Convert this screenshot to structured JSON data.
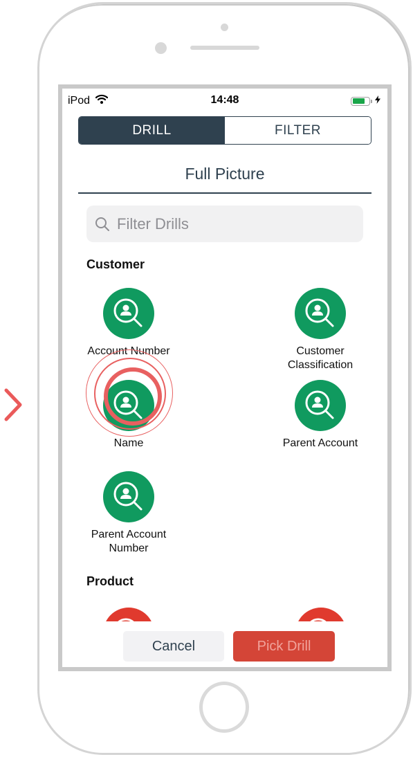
{
  "device": {
    "type": "iPod",
    "home_button": "home-button",
    "nav_arrow": "chevron-right-icon"
  },
  "status_bar": {
    "carrier": "iPod",
    "wifi_icon": "wifi-icon",
    "time": "14:48",
    "battery_level": 0.75,
    "charging_icon": "bolt-icon"
  },
  "segmented_control": {
    "tabs": [
      {
        "label": "DRILL",
        "active": true
      },
      {
        "label": "FILTER",
        "active": false
      }
    ]
  },
  "page_title": "Full Picture",
  "search": {
    "placeholder": "Filter Drills",
    "value": ""
  },
  "sections": [
    {
      "label": "Customer",
      "items": [
        {
          "label": "Account Number",
          "icon": "user-search-icon",
          "color": "#109a5f"
        },
        {
          "label": "Customer Classification",
          "icon": "user-search-icon",
          "color": "#109a5f"
        },
        {
          "label": "Name",
          "icon": "user-search-icon",
          "color": "#109a5f",
          "tapped": true
        },
        {
          "label": "Parent Account",
          "icon": "user-search-icon",
          "color": "#109a5f"
        },
        {
          "label": "Parent Account Number",
          "icon": "user-search-icon",
          "color": "#109a5f"
        }
      ]
    },
    {
      "label": "Product",
      "items": [
        {
          "label": "",
          "icon": "product-search-icon",
          "color": "#e03a2e"
        },
        {
          "label": "",
          "icon": "product-search-icon",
          "color": "#e03a2e"
        }
      ]
    }
  ],
  "footer": {
    "cancel_label": "Cancel",
    "pick_label": "Pick Drill"
  },
  "colors": {
    "primary_dark": "#2f414f",
    "green": "#109a5f",
    "red": "#d44537",
    "tap_ripple": "#e86060"
  }
}
